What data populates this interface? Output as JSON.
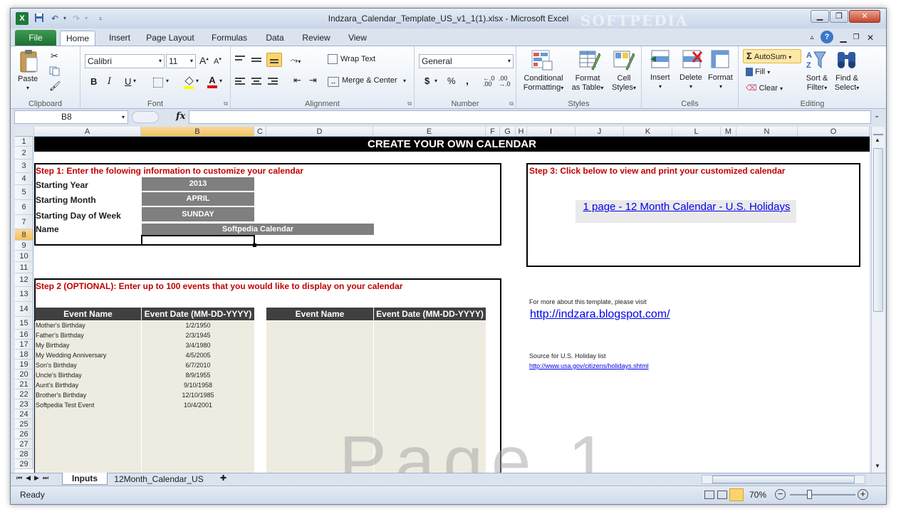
{
  "window": {
    "title": "Indzara_Calendar_Template_US_v1_1(1).xlsx  -  Microsoft Excel",
    "watermark": "SOFTPEDIA"
  },
  "ribbon": {
    "tabs": [
      "File",
      "Home",
      "Insert",
      "Page Layout",
      "Formulas",
      "Data",
      "Review",
      "View"
    ],
    "clipboard": {
      "paste": "Paste",
      "label": "Clipboard"
    },
    "font": {
      "name": "Calibri",
      "size": "11",
      "label": "Font",
      "bold": "B",
      "italic": "I",
      "underline": "U"
    },
    "alignment": {
      "wrap_text": "Wrap Text",
      "merge_center": "Merge & Center",
      "label": "Alignment"
    },
    "number": {
      "format": "General",
      "label": "Number",
      "dollar": "$",
      "percent": "%",
      "comma": ","
    },
    "styles": {
      "conditional": [
        "Conditional",
        "Formatting"
      ],
      "format_table": [
        "Format",
        "as Table"
      ],
      "cell_styles": [
        "Cell",
        "Styles"
      ],
      "label": "Styles"
    },
    "cells": {
      "insert": "Insert",
      "delete": "Delete",
      "format": "Format",
      "label": "Cells"
    },
    "editing": {
      "autosum": "AutoSum",
      "fill": "Fill",
      "clear": "Clear",
      "sort": [
        "Sort &",
        "Filter"
      ],
      "find": [
        "Find &",
        "Select"
      ],
      "label": "Editing"
    }
  },
  "formula_bar": {
    "name_box": "B8",
    "fx": "fx",
    "formula": ""
  },
  "grid": {
    "columns": [
      "A",
      "B",
      "C",
      "D",
      "E",
      "F",
      "G",
      "H",
      "I",
      "J",
      "K",
      "L",
      "M",
      "N",
      "O"
    ],
    "rows": [
      "1",
      "2",
      "3",
      "4",
      "5",
      "6",
      "7",
      "8",
      "9",
      "10",
      "11",
      "12",
      "13",
      "14",
      "15",
      "16",
      "17",
      "18",
      "19",
      "20",
      "21",
      "22",
      "23",
      "24",
      "25",
      "26",
      "27",
      "28",
      "29"
    ],
    "selected_col": "B",
    "selected_row": "8"
  },
  "content": {
    "banner": "CREATE YOUR OWN CALENDAR",
    "step1": "Step 1: Enter the folowing information to customize your calendar",
    "fields": [
      {
        "label": "Starting Year",
        "value": "2013"
      },
      {
        "label": "Starting Month",
        "value": "APRIL"
      },
      {
        "label": "Starting Day of Week",
        "value": "SUNDAY"
      },
      {
        "label": "Name",
        "value": "Softpedia Calendar"
      }
    ],
    "step2": "Step 2 (OPTIONAL): Enter up to 100 events that you would like to display on your calendar",
    "event_headers": [
      "Event Name",
      "Event Date (MM-DD-YYYY)",
      "Event Name",
      "Event Date (MM-DD-YYYY)"
    ],
    "events": [
      {
        "name": "Mother's Birthday",
        "date": "1/2/1950"
      },
      {
        "name": "Father's Birthday",
        "date": "2/3/1945"
      },
      {
        "name": "My Birthday",
        "date": "3/4/1980"
      },
      {
        "name": "My Wedding Anniversary",
        "date": "4/5/2005"
      },
      {
        "name": "Son's Birthday",
        "date": "6/7/2010"
      },
      {
        "name": "Uncle's Birthday",
        "date": "8/9/1955"
      },
      {
        "name": "Aunt's Birthday",
        "date": "9/10/1958"
      },
      {
        "name": "Brother's Birthday",
        "date": "12/10/1985"
      },
      {
        "name": "Softpedia Test Event",
        "date": "10/4/2001"
      }
    ],
    "step3": "Step 3: Click below to view and print your customized calendar",
    "calendar_link": "1 page - 12 Month Calendar - U.S. Holidays",
    "more_info": "For more about this template, please visit",
    "more_link": "http://indzara.blogspot.com/",
    "source_text": "Source for U.S. Holiday list",
    "source_link": "http://www.usa.gov/citizens/holidays.shtml",
    "page_watermark": "Page 1"
  },
  "sheet_tabs": [
    "Inputs",
    "12Month_Calendar_US"
  ],
  "status": {
    "ready": "Ready",
    "zoom": "70%"
  }
}
